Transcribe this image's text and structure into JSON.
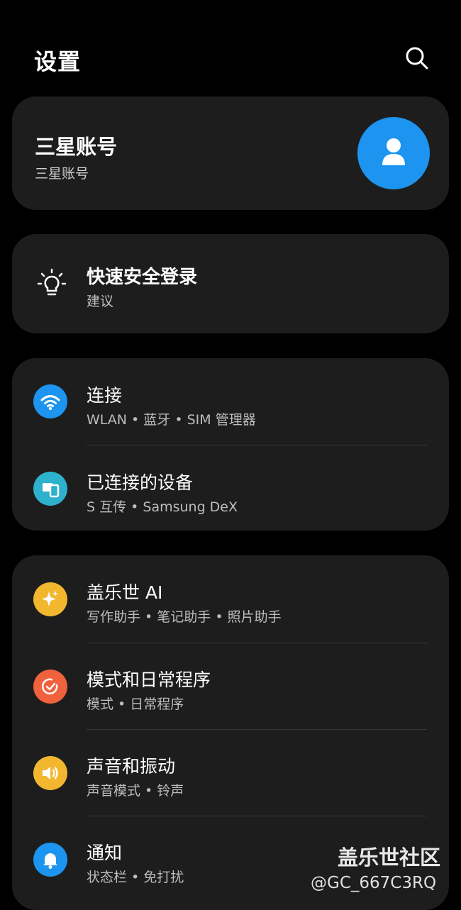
{
  "header": {
    "title": "设置"
  },
  "account": {
    "title": "三星账号",
    "subtitle": "三星账号"
  },
  "tip": {
    "title": "快速安全登录",
    "subtitle": "建议"
  },
  "connections": [
    {
      "title": "连接",
      "subtitle": "WLAN • 蓝牙 • SIM 管理器",
      "icon": "wifi-icon",
      "color": "#1c94f0"
    },
    {
      "title": "已连接的设备",
      "subtitle": "S 互传 • Samsung DeX",
      "icon": "connected-devices-icon",
      "color": "#2eb1cc"
    }
  ],
  "main": [
    {
      "title": "盖乐世 AI",
      "subtitle": "写作助手 • 笔记助手 • 照片助手",
      "icon": "sparkle-icon",
      "color": "#f2b72f"
    },
    {
      "title": "模式和日常程序",
      "subtitle": "模式 • 日常程序",
      "icon": "modes-routines-icon",
      "color": "#f0613d"
    },
    {
      "title": "声音和振动",
      "subtitle": "声音模式 • 铃声",
      "icon": "speaker-icon",
      "color": "#f2b72f"
    },
    {
      "title": "通知",
      "subtitle": "状态栏 • 免打扰",
      "icon": "bell-icon",
      "color": "#1c94f0"
    }
  ],
  "watermark": {
    "line1": "盖乐世社区",
    "line2": "@GC_667C3RQ"
  }
}
